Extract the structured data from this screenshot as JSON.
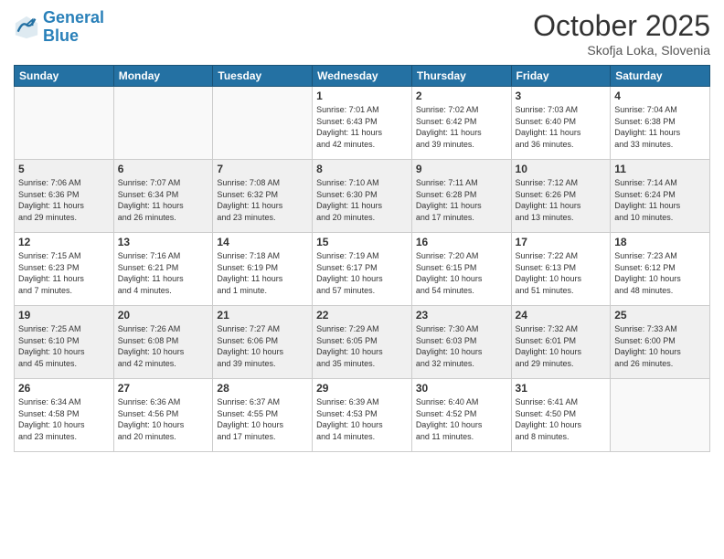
{
  "header": {
    "logo_line1": "General",
    "logo_line2": "Blue",
    "month": "October 2025",
    "location": "Skofja Loka, Slovenia"
  },
  "weekdays": [
    "Sunday",
    "Monday",
    "Tuesday",
    "Wednesday",
    "Thursday",
    "Friday",
    "Saturday"
  ],
  "weeks": [
    [
      {
        "day": "",
        "info": ""
      },
      {
        "day": "",
        "info": ""
      },
      {
        "day": "",
        "info": ""
      },
      {
        "day": "1",
        "info": "Sunrise: 7:01 AM\nSunset: 6:43 PM\nDaylight: 11 hours\nand 42 minutes."
      },
      {
        "day": "2",
        "info": "Sunrise: 7:02 AM\nSunset: 6:42 PM\nDaylight: 11 hours\nand 39 minutes."
      },
      {
        "day": "3",
        "info": "Sunrise: 7:03 AM\nSunset: 6:40 PM\nDaylight: 11 hours\nand 36 minutes."
      },
      {
        "day": "4",
        "info": "Sunrise: 7:04 AM\nSunset: 6:38 PM\nDaylight: 11 hours\nand 33 minutes."
      }
    ],
    [
      {
        "day": "5",
        "info": "Sunrise: 7:06 AM\nSunset: 6:36 PM\nDaylight: 11 hours\nand 29 minutes."
      },
      {
        "day": "6",
        "info": "Sunrise: 7:07 AM\nSunset: 6:34 PM\nDaylight: 11 hours\nand 26 minutes."
      },
      {
        "day": "7",
        "info": "Sunrise: 7:08 AM\nSunset: 6:32 PM\nDaylight: 11 hours\nand 23 minutes."
      },
      {
        "day": "8",
        "info": "Sunrise: 7:10 AM\nSunset: 6:30 PM\nDaylight: 11 hours\nand 20 minutes."
      },
      {
        "day": "9",
        "info": "Sunrise: 7:11 AM\nSunset: 6:28 PM\nDaylight: 11 hours\nand 17 minutes."
      },
      {
        "day": "10",
        "info": "Sunrise: 7:12 AM\nSunset: 6:26 PM\nDaylight: 11 hours\nand 13 minutes."
      },
      {
        "day": "11",
        "info": "Sunrise: 7:14 AM\nSunset: 6:24 PM\nDaylight: 11 hours\nand 10 minutes."
      }
    ],
    [
      {
        "day": "12",
        "info": "Sunrise: 7:15 AM\nSunset: 6:23 PM\nDaylight: 11 hours\nand 7 minutes."
      },
      {
        "day": "13",
        "info": "Sunrise: 7:16 AM\nSunset: 6:21 PM\nDaylight: 11 hours\nand 4 minutes."
      },
      {
        "day": "14",
        "info": "Sunrise: 7:18 AM\nSunset: 6:19 PM\nDaylight: 11 hours\nand 1 minute."
      },
      {
        "day": "15",
        "info": "Sunrise: 7:19 AM\nSunset: 6:17 PM\nDaylight: 10 hours\nand 57 minutes."
      },
      {
        "day": "16",
        "info": "Sunrise: 7:20 AM\nSunset: 6:15 PM\nDaylight: 10 hours\nand 54 minutes."
      },
      {
        "day": "17",
        "info": "Sunrise: 7:22 AM\nSunset: 6:13 PM\nDaylight: 10 hours\nand 51 minutes."
      },
      {
        "day": "18",
        "info": "Sunrise: 7:23 AM\nSunset: 6:12 PM\nDaylight: 10 hours\nand 48 minutes."
      }
    ],
    [
      {
        "day": "19",
        "info": "Sunrise: 7:25 AM\nSunset: 6:10 PM\nDaylight: 10 hours\nand 45 minutes."
      },
      {
        "day": "20",
        "info": "Sunrise: 7:26 AM\nSunset: 6:08 PM\nDaylight: 10 hours\nand 42 minutes."
      },
      {
        "day": "21",
        "info": "Sunrise: 7:27 AM\nSunset: 6:06 PM\nDaylight: 10 hours\nand 39 minutes."
      },
      {
        "day": "22",
        "info": "Sunrise: 7:29 AM\nSunset: 6:05 PM\nDaylight: 10 hours\nand 35 minutes."
      },
      {
        "day": "23",
        "info": "Sunrise: 7:30 AM\nSunset: 6:03 PM\nDaylight: 10 hours\nand 32 minutes."
      },
      {
        "day": "24",
        "info": "Sunrise: 7:32 AM\nSunset: 6:01 PM\nDaylight: 10 hours\nand 29 minutes."
      },
      {
        "day": "25",
        "info": "Sunrise: 7:33 AM\nSunset: 6:00 PM\nDaylight: 10 hours\nand 26 minutes."
      }
    ],
    [
      {
        "day": "26",
        "info": "Sunrise: 6:34 AM\nSunset: 4:58 PM\nDaylight: 10 hours\nand 23 minutes."
      },
      {
        "day": "27",
        "info": "Sunrise: 6:36 AM\nSunset: 4:56 PM\nDaylight: 10 hours\nand 20 minutes."
      },
      {
        "day": "28",
        "info": "Sunrise: 6:37 AM\nSunset: 4:55 PM\nDaylight: 10 hours\nand 17 minutes."
      },
      {
        "day": "29",
        "info": "Sunrise: 6:39 AM\nSunset: 4:53 PM\nDaylight: 10 hours\nand 14 minutes."
      },
      {
        "day": "30",
        "info": "Sunrise: 6:40 AM\nSunset: 4:52 PM\nDaylight: 10 hours\nand 11 minutes."
      },
      {
        "day": "31",
        "info": "Sunrise: 6:41 AM\nSunset: 4:50 PM\nDaylight: 10 hours\nand 8 minutes."
      },
      {
        "day": "",
        "info": ""
      }
    ]
  ]
}
